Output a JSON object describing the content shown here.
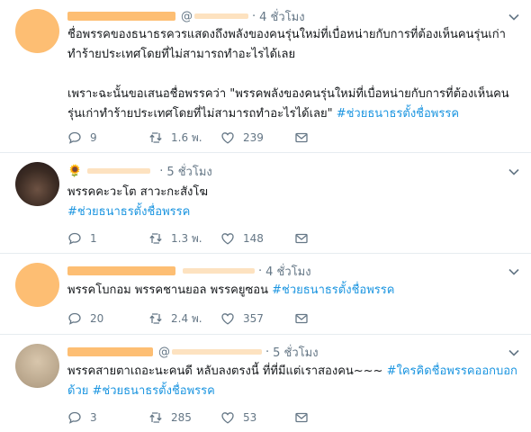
{
  "tweets": [
    {
      "handle": "@",
      "dot": "·",
      "time": "4 ชั่วโมง",
      "emoji": "",
      "paragraphs": [
        {
          "text": "ชื่อพรรคของธนาธรควรแสดงถึงพลังของคนรุ่นใหม่ที่เบื่อหน่ายกับการที่ต้องเห็นคนรุ่นเก่าทำร้ายประเทศโดยที่ไม่สามารถทำอะไรได้เลย",
          "tags": ""
        },
        {
          "text": "เพราะฉะนั้นขอเสนอชื่อพรรคว่า \"พรรคพลังของคนรุ่นใหม่ที่เบื่อหน่ายกับการที่ต้องเห็นคนรุ่นเก่าทำร้ายประเทศโดยที่ไม่สามารถทำอะไรได้เลย\" ",
          "tags": "#ช่วยธนาธรตั้งชื่อพรรค"
        }
      ],
      "replies": "9",
      "retweets": "1.6 พ.",
      "likes": "239"
    },
    {
      "handle": "",
      "dot": "·",
      "time": "5 ชั่วโมง",
      "emoji": "🌻",
      "paragraphs": [
        {
          "text": "พรรคคะวะโต สาวะกะสังโฆ",
          "tags": ""
        },
        {
          "text": "",
          "tags": "#ช่วยธนาธรตั้งชื่อพรรค"
        }
      ],
      "replies": "1",
      "retweets": "1.3 พ.",
      "likes": "148"
    },
    {
      "handle": "",
      "dot": "·",
      "time": "4 ชั่วโมง",
      "emoji": "",
      "paragraphs": [
        {
          "text": "พรรคโบกอม พรรคชานยอล พรรคยูซอน ",
          "tags": "#ช่วยธนาธรตั้งชื่อพรรค"
        }
      ],
      "replies": "20",
      "retweets": "2.4 พ.",
      "likes": "357"
    },
    {
      "handle": "@",
      "dot": "·",
      "time": "5 ชั่วโมง",
      "emoji": "",
      "paragraphs": [
        {
          "text": "พรรคสายตาเถอะนะคนดี หลับลงตรงนี้ ที่ที่มีแต่เราสองคน~~~ ",
          "tags": "#ใครคิดชื่อพรรคออกบอกด้วย #ช่วยธนาธรตั้งชื่อพรรค"
        }
      ],
      "replies": "3",
      "retweets": "285",
      "likes": "53"
    }
  ],
  "icons": {
    "reply": "reply-icon",
    "retweet": "retweet-icon",
    "like": "heart-icon",
    "dm": "envelope-icon",
    "more": "chevron-down-icon"
  },
  "colors": {
    "hashtag": "#1b95e0",
    "muted": "#657786",
    "redaction": "#fdbe73",
    "divider": "#e6ecf0"
  }
}
